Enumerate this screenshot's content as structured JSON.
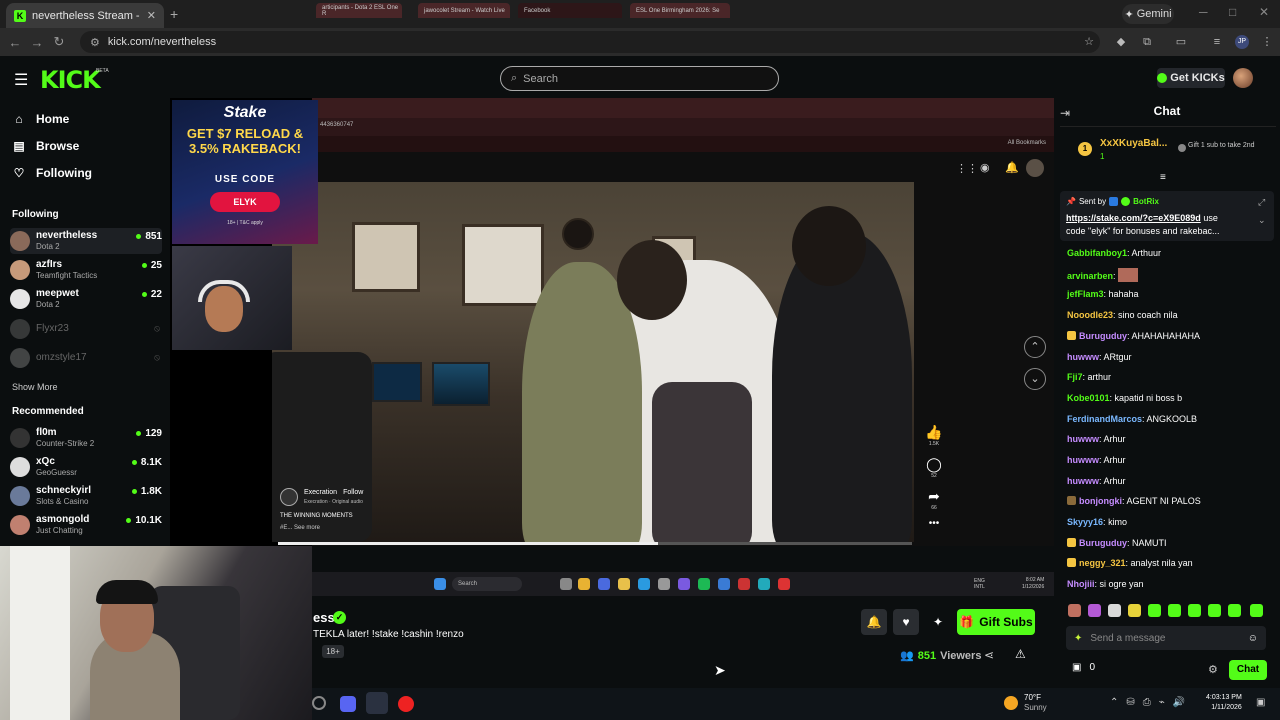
{
  "browser": {
    "tab_title": "nevertheless Stream - Watch Li",
    "url": "kick.com/nevertheless",
    "gemini_label": "Gemini"
  },
  "header": {
    "logo": "KICK",
    "beta": "BETA",
    "search_placeholder": "Search",
    "get_kicks": "Get KICKs"
  },
  "sidebar": {
    "nav": [
      {
        "label": "Home",
        "icon": "home-icon"
      },
      {
        "label": "Browse",
        "icon": "browse-icon"
      },
      {
        "label": "Following",
        "icon": "heart-icon"
      }
    ],
    "following_title": "Following",
    "following": [
      {
        "name": "nevertheless",
        "game": "Dota 2",
        "viewers": "851",
        "color": "#8a6a5a"
      },
      {
        "name": "azfIrs",
        "game": "Teamfight Tactics",
        "viewers": "25",
        "color": "#c79a7a"
      },
      {
        "name": "meepwet",
        "game": "Dota 2",
        "viewers": "22",
        "color": "#e6e6e6"
      },
      {
        "name": "Flyxr23",
        "color": "#888"
      },
      {
        "name": "omzstyle17",
        "color": "#aaa"
      }
    ],
    "show_more": "Show More",
    "recommended_title": "Recommended",
    "recommended": [
      {
        "name": "fl0m",
        "game": "Counter-Strike 2",
        "viewers": "129",
        "color": "#333"
      },
      {
        "name": "xQc",
        "game": "GeoGuessr",
        "viewers": "8.1K",
        "color": "#ddd"
      },
      {
        "name": "schneckyirl",
        "game": "Slots & Casino",
        "viewers": "1.8K",
        "color": "#6a7a9a"
      },
      {
        "name": "asmongold",
        "game": "Just Chatting",
        "viewers": "10.1K",
        "color": "#c08070"
      }
    ]
  },
  "stream": {
    "stake_logo": "Stake",
    "stake_headline": "GET $7 RELOAD & 3.5% RAKEBACK!",
    "stake_use": "USE CODE",
    "stake_code": "ELYK",
    "stake_tc": "18+ | T&C apply",
    "ss_tabs": [
      "articipants - Dota 2 ESL One R",
      "jawocolet Stream - Watch Live",
      "Facebook",
      "ESL One Birmingham 2026: Se"
    ],
    "ss_url": "4436360747",
    "ss_bookmarks": "All Bookmarks",
    "credit_name": "Execration",
    "credit_follow": "Follow",
    "credit_audio": "Execration · Original audio",
    "credit_caption": "THE WINNING MOMENTS",
    "credit_more": "#E... See more",
    "like_count": "1.5K",
    "comment_count": "52",
    "share_count": "66",
    "taskbar_search": "Search",
    "task_time": "8:02 AM",
    "task_date": "1/12/2026",
    "task_lang": "ENG\nINTL",
    "progress": 0.6
  },
  "info": {
    "channel_name_partial": "ess",
    "title_partial": "TEKLA later! !stake !cashin !renzo",
    "age_badge": "18+",
    "gift_subs": "Gift Subs",
    "viewers_count": "851",
    "viewers_label": "Viewers"
  },
  "chat": {
    "title": "Chat",
    "top_gifter": "XxXKuyaBal...",
    "top_gifter_count": "1",
    "gift_prompt": "Gift 1 sub to take 2nd",
    "sent_by_label": "Sent by",
    "sent_by_user": "BotRix",
    "sent_link": "https://stake.com/?c=eX9E089d",
    "sent_text_1": " use",
    "sent_text_2": "code \"elyk\" for bonuses and rakebac...",
    "messages": [
      {
        "user": "Gabbifanboy1",
        "text": "Arthuur",
        "color": "#53fc18"
      },
      {
        "user": "arvinarben",
        "text": "",
        "color": "#53fc18",
        "emote": true
      },
      {
        "user": "jefFlam3",
        "text": "hahaha",
        "color": "#53fc18"
      },
      {
        "user": "Nooodle23",
        "text": "sino coach nila",
        "color": "#f5c542"
      },
      {
        "user": "Buruguduy",
        "text": "AHAHAHAHAHA",
        "color": "#c58cff",
        "badge": "#f5c542"
      },
      {
        "user": "huwww",
        "text": "ARtgur",
        "color": "#c58cff"
      },
      {
        "user": "Fji7",
        "text": "arthur",
        "color": "#53fc18"
      },
      {
        "user": "Kobe0101",
        "text": "kapatid ni boss b",
        "color": "#53fc18"
      },
      {
        "user": "FerdinandMarcos",
        "text": "ANGKOOLB",
        "color": "#7ab8ff"
      },
      {
        "user": "huwww",
        "text": "Arhur",
        "color": "#c58cff"
      },
      {
        "user": "huwww",
        "text": "Arhur",
        "color": "#c58cff"
      },
      {
        "user": "huwww",
        "text": "Arhur",
        "color": "#c58cff"
      },
      {
        "user": "bonjongki",
        "text": "AGENT NI PALOS",
        "color": "#c58cff",
        "badge": "#8a6a3a"
      },
      {
        "user": "Skyyy16",
        "text": "kimo",
        "color": "#7ab8ff"
      },
      {
        "user": "Buruguduy",
        "text": "NAMUTI",
        "color": "#c58cff",
        "badge": "#f5c542"
      },
      {
        "user": "neggy_321",
        "text": "analyst nila yan",
        "color": "#f5c542",
        "badge": "#f5c542"
      },
      {
        "user": "Nhojiii",
        "text": "si ogre yan",
        "color": "#c58cff"
      }
    ],
    "send_placeholder": "Send a message",
    "points": "0",
    "chat_button": "Chat"
  },
  "windows": {
    "temp": "70°F",
    "weather": "Sunny",
    "time": "4:03:13 PM",
    "date": "1/11/2026"
  },
  "colors": {
    "kick_green": "#53fc18",
    "bg": "#0b0e0f",
    "stake_red": "#e2143f"
  }
}
